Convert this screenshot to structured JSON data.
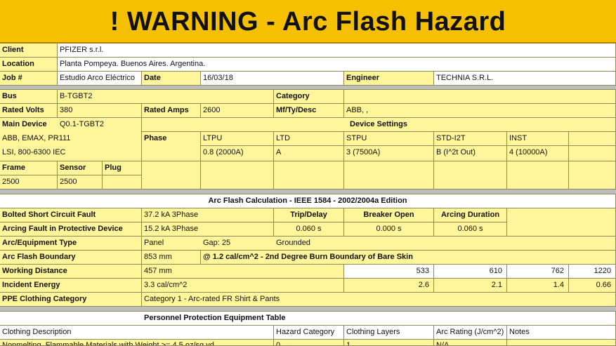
{
  "title": "!   WARNING - Arc Flash Hazard",
  "labels": {
    "client": "Client",
    "location": "Location",
    "job": "Job #",
    "date": "Date",
    "engineer": "Engineer",
    "bus": "Bus",
    "category": "Category",
    "rated_volts": "Rated Volts",
    "rated_amps": "Rated Amps",
    "mf_ty_desc": "Mf/Ty/Desc",
    "main_device": "Main Device",
    "device_settings": "Device Settings",
    "phase": "Phase",
    "frame": "Frame",
    "sensor": "Sensor",
    "plug": "Plug",
    "arc_calc": "Arc Flash Calculation - IEEE 1584 - 2002/2004a Edition",
    "bolted": "Bolted Short Circuit Fault",
    "trip_delay": "Trip/Delay",
    "breaker_open": "Breaker Open",
    "arcing_duration": "Arcing Duration",
    "arcing_fault": "Arcing Fault in Protective Device",
    "arc_equipment": "Arc/Equipment Type",
    "arc_boundary": "Arc Flash Boundary",
    "working_distance": "Working Distance",
    "incident_energy": "Incident Energy",
    "ppe": "PPE Clothing Category",
    "ppe_table": "Personnel Protection Equipment Table"
  },
  "values": {
    "client": "PFIZER s.r.l.",
    "location": "Planta Pompeya. Buenos Aires. Argentina.",
    "job": "Estudio Arco Eléctrico",
    "date": "16/03/18",
    "engineer": "TECHNIA S.R.L.",
    "bus": "B-TGBT2",
    "rated_volts": "380",
    "rated_amps": "2600",
    "mf_ty_desc": "ABB, ,",
    "main_device": "Q0.1-TGBT2",
    "main_device_line2": "ABB, EMAX, PR111",
    "main_device_line3": "LSI, 800-6300 IEC",
    "frame": "2500",
    "sensor": "2500"
  },
  "device_settings": {
    "headers": [
      "LTPU",
      "LTD",
      "STPU",
      "STD-I2T",
      "INST"
    ],
    "values": [
      "0.8 (2000A)",
      "A",
      "3 (7500A)",
      "B (I^2t Out)",
      "4 (10000A)"
    ]
  },
  "arc": {
    "bolted": "37.2 kA 3Phase",
    "arcing_fault": "15.2 kA 3Phase",
    "trip_delay": "0.060 s",
    "breaker_open": "0.000 s",
    "arcing_duration": "0.060 s",
    "equipment_type": "Panel",
    "gap": "Gap: 25",
    "grounded": "Grounded",
    "boundary": "853 mm",
    "boundary_note": "@ 1.2 cal/cm^2 - 2nd Degree Burn Boundary of Bare Skin",
    "working_distance": "457 mm",
    "incident_energy": "3.3 cal/cm^2",
    "distances": [
      "533",
      "610",
      "762",
      "1220"
    ],
    "energies": [
      "2.6",
      "2.1",
      "1.4",
      "0.66"
    ],
    "ppe": "Category 1 - Arc-rated FR Shirt & Pants"
  },
  "ppe_table": {
    "headers": [
      "Clothing Description",
      "Hazard Category",
      "Clothing Layers",
      "Arc Rating (J/cm^2)",
      "Notes"
    ],
    "row": [
      "Nonmelting, Flammable Materials with Weight >= 4.5 oz/sq.yd",
      "0",
      "1",
      "N/A"
    ]
  }
}
